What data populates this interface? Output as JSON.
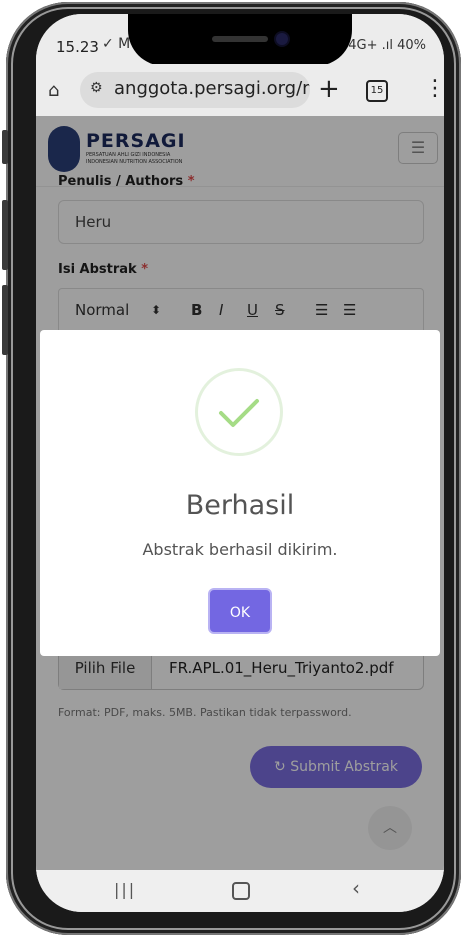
{
  "status_bar": {
    "time": "15.23",
    "notif_icons": "✓ M",
    "right_text": "4G+ .ıl 40%"
  },
  "browser": {
    "url": "anggota.persagi.org/m",
    "tab_count": "15"
  },
  "site_header": {
    "title": "PERSAGI",
    "subtitle_line1": "PERSATUAN AHLI GIZI INDONESIA",
    "subtitle_line2": "INDONESIAN NUTRITION ASSOCIATION"
  },
  "form": {
    "authors_label": "Penulis / Authors",
    "authors_value": "Heru",
    "abstract_label": "Isi Abstrak",
    "required_mark": "*",
    "editor_toolbar": {
      "format_select": "Normal",
      "select_arrow": "⬍",
      "bold": "B",
      "italic": "I",
      "underline": "U",
      "strike": "S",
      "ordered_list": "☰",
      "bullet_list": "☰"
    },
    "file_button": "Pilih File",
    "file_name": "FR.APL.01_Heru_Triyanto2.pdf",
    "file_hint": "Format: PDF, maks. 5MB. Pastikan tidak terpassword.",
    "submit_label": "Submit Abstrak"
  },
  "modal": {
    "title": "Berhasil",
    "message": "Abstrak berhasil dikirim.",
    "ok_label": "OK"
  },
  "colors": {
    "accent": "#7367e2",
    "success": "#a5dc86",
    "required": "#e24c4c"
  }
}
